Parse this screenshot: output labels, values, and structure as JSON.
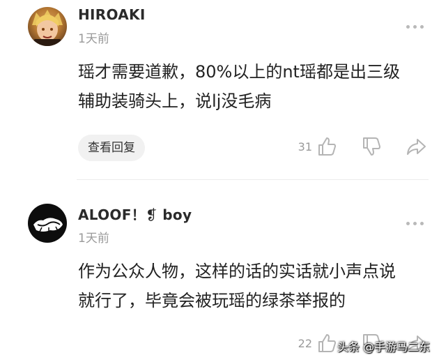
{
  "comments": [
    {
      "username": "HIROAKI",
      "time": "1天前",
      "content_lines": [
        "瑶才需要道歉，80%以上的nt瑶都是出三级",
        "辅助装骑头上，说lj没毛病"
      ],
      "reply_label": "查看回复",
      "like_count": "31"
    },
    {
      "username": "ALOOF！❡ boy",
      "time": "1天前",
      "content_lines": [
        "作为公众人物，这样的话的实话就小声点说",
        "就行了，毕竟会被玩瑶的绿茶举报的"
      ],
      "like_count": "22"
    }
  ],
  "watermark": "头条 @手游马二东",
  "icons": [
    "avatar",
    "more-icon",
    "thumbs-up-icon",
    "thumbs-down-icon",
    "share-icon"
  ]
}
